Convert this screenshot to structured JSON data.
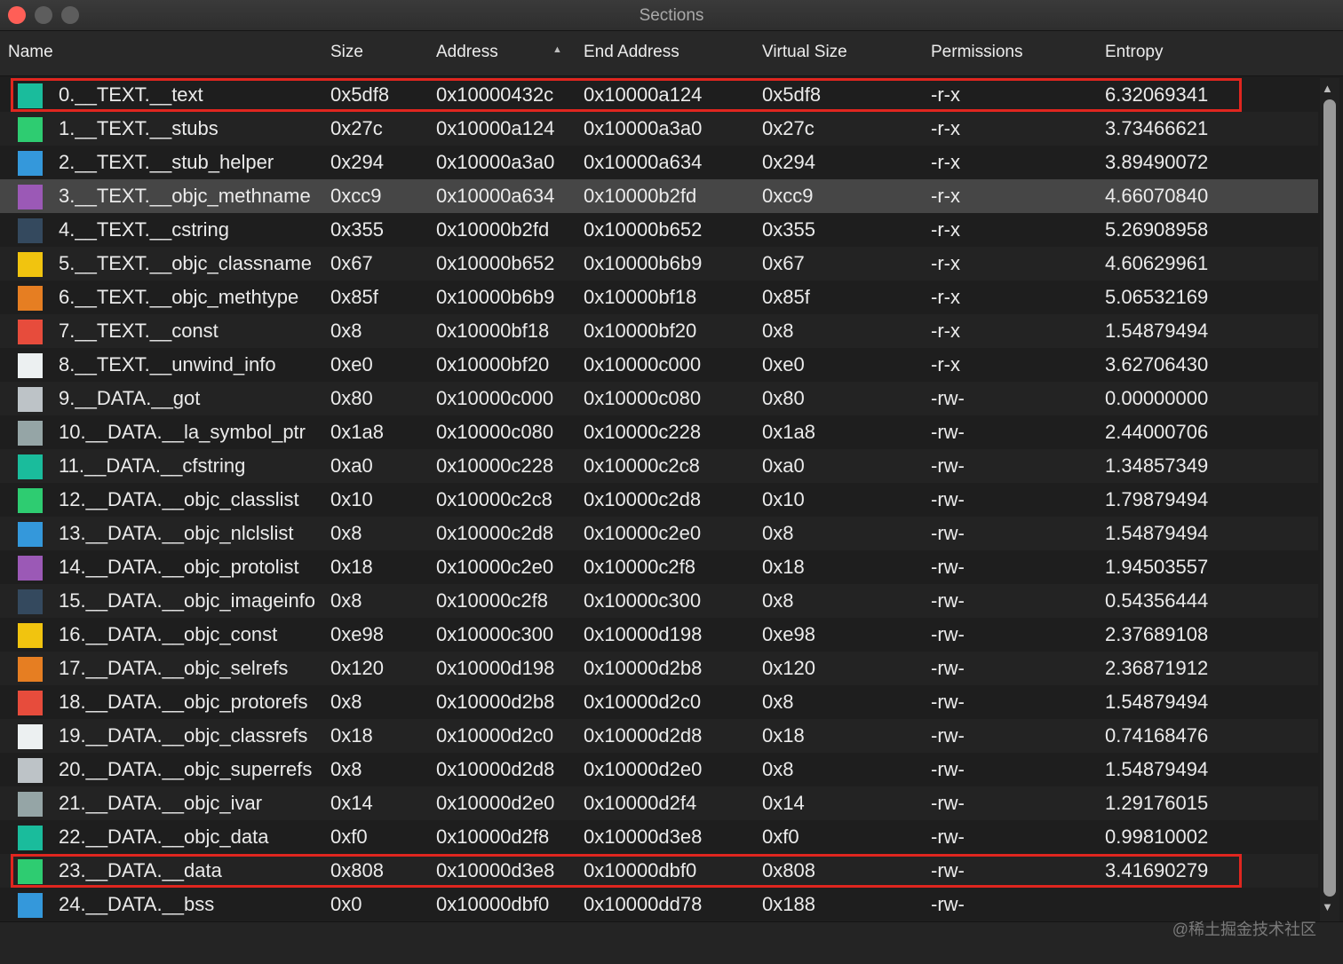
{
  "window": {
    "title": "Sections"
  },
  "columns": {
    "name": "Name",
    "size": "Size",
    "address": "Address",
    "end_address": "End Address",
    "virtual_size": "Virtual Size",
    "permissions": "Permissions",
    "entropy": "Entropy"
  },
  "sort_indicator": "▲",
  "scroll": {
    "up": "▲",
    "down": "▼"
  },
  "watermark": "@稀土掘金技术社区",
  "selected_row": 3,
  "highlighted_rows": [
    0,
    23
  ],
  "rows": [
    {
      "color": "#1abc9c",
      "name": "0.__TEXT.__text",
      "size": "0x5df8",
      "address": "0x10000432c",
      "end": "0x10000a124",
      "vsize": "0x5df8",
      "perm": "-r-x",
      "entropy": "6.32069341"
    },
    {
      "color": "#2ecc71",
      "name": "1.__TEXT.__stubs",
      "size": "0x27c",
      "address": "0x10000a124",
      "end": "0x10000a3a0",
      "vsize": "0x27c",
      "perm": "-r-x",
      "entropy": "3.73466621"
    },
    {
      "color": "#3498db",
      "name": "2.__TEXT.__stub_helper",
      "size": "0x294",
      "address": "0x10000a3a0",
      "end": "0x10000a634",
      "vsize": "0x294",
      "perm": "-r-x",
      "entropy": "3.89490072"
    },
    {
      "color": "#9b59b6",
      "name": "3.__TEXT.__objc_methname",
      "size": "0xcc9",
      "address": "0x10000a634",
      "end": "0x10000b2fd",
      "vsize": "0xcc9",
      "perm": "-r-x",
      "entropy": "4.66070840"
    },
    {
      "color": "#34495e",
      "name": "4.__TEXT.__cstring",
      "size": "0x355",
      "address": "0x10000b2fd",
      "end": "0x10000b652",
      "vsize": "0x355",
      "perm": "-r-x",
      "entropy": "5.26908958"
    },
    {
      "color": "#f1c40f",
      "name": "5.__TEXT.__objc_classname",
      "size": "0x67",
      "address": "0x10000b652",
      "end": "0x10000b6b9",
      "vsize": "0x67",
      "perm": "-r-x",
      "entropy": "4.60629961"
    },
    {
      "color": "#e67e22",
      "name": "6.__TEXT.__objc_methtype",
      "size": "0x85f",
      "address": "0x10000b6b9",
      "end": "0x10000bf18",
      "vsize": "0x85f",
      "perm": "-r-x",
      "entropy": "5.06532169"
    },
    {
      "color": "#e74c3c",
      "name": "7.__TEXT.__const",
      "size": "0x8",
      "address": "0x10000bf18",
      "end": "0x10000bf20",
      "vsize": "0x8",
      "perm": "-r-x",
      "entropy": "1.54879494"
    },
    {
      "color": "#ecf0f1",
      "name": "8.__TEXT.__unwind_info",
      "size": "0xe0",
      "address": "0x10000bf20",
      "end": "0x10000c000",
      "vsize": "0xe0",
      "perm": "-r-x",
      "entropy": "3.62706430"
    },
    {
      "color": "#bdc3c7",
      "name": "9.__DATA.__got",
      "size": "0x80",
      "address": "0x10000c000",
      "end": "0x10000c080",
      "vsize": "0x80",
      "perm": "-rw-",
      "entropy": "0.00000000"
    },
    {
      "color": "#95a5a6",
      "name": "10.__DATA.__la_symbol_ptr",
      "size": "0x1a8",
      "address": "0x10000c080",
      "end": "0x10000c228",
      "vsize": "0x1a8",
      "perm": "-rw-",
      "entropy": "2.44000706"
    },
    {
      "color": "#1abc9c",
      "name": "11.__DATA.__cfstring",
      "size": "0xa0",
      "address": "0x10000c228",
      "end": "0x10000c2c8",
      "vsize": "0xa0",
      "perm": "-rw-",
      "entropy": "1.34857349"
    },
    {
      "color": "#2ecc71",
      "name": "12.__DATA.__objc_classlist",
      "size": "0x10",
      "address": "0x10000c2c8",
      "end": "0x10000c2d8",
      "vsize": "0x10",
      "perm": "-rw-",
      "entropy": "1.79879494"
    },
    {
      "color": "#3498db",
      "name": "13.__DATA.__objc_nlclslist",
      "size": "0x8",
      "address": "0x10000c2d8",
      "end": "0x10000c2e0",
      "vsize": "0x8",
      "perm": "-rw-",
      "entropy": "1.54879494"
    },
    {
      "color": "#9b59b6",
      "name": "14.__DATA.__objc_protolist",
      "size": "0x18",
      "address": "0x10000c2e0",
      "end": "0x10000c2f8",
      "vsize": "0x18",
      "perm": "-rw-",
      "entropy": "1.94503557"
    },
    {
      "color": "#34495e",
      "name": "15.__DATA.__objc_imageinfo",
      "size": "0x8",
      "address": "0x10000c2f8",
      "end": "0x10000c300",
      "vsize": "0x8",
      "perm": "-rw-",
      "entropy": "0.54356444"
    },
    {
      "color": "#f1c40f",
      "name": "16.__DATA.__objc_const",
      "size": "0xe98",
      "address": "0x10000c300",
      "end": "0x10000d198",
      "vsize": "0xe98",
      "perm": "-rw-",
      "entropy": "2.37689108"
    },
    {
      "color": "#e67e22",
      "name": "17.__DATA.__objc_selrefs",
      "size": "0x120",
      "address": "0x10000d198",
      "end": "0x10000d2b8",
      "vsize": "0x120",
      "perm": "-rw-",
      "entropy": "2.36871912"
    },
    {
      "color": "#e74c3c",
      "name": "18.__DATA.__objc_protorefs",
      "size": "0x8",
      "address": "0x10000d2b8",
      "end": "0x10000d2c0",
      "vsize": "0x8",
      "perm": "-rw-",
      "entropy": "1.54879494"
    },
    {
      "color": "#ecf0f1",
      "name": "19.__DATA.__objc_classrefs",
      "size": "0x18",
      "address": "0x10000d2c0",
      "end": "0x10000d2d8",
      "vsize": "0x18",
      "perm": "-rw-",
      "entropy": "0.74168476"
    },
    {
      "color": "#bdc3c7",
      "name": "20.__DATA.__objc_superrefs",
      "size": "0x8",
      "address": "0x10000d2d8",
      "end": "0x10000d2e0",
      "vsize": "0x8",
      "perm": "-rw-",
      "entropy": "1.54879494"
    },
    {
      "color": "#95a5a6",
      "name": "21.__DATA.__objc_ivar",
      "size": "0x14",
      "address": "0x10000d2e0",
      "end": "0x10000d2f4",
      "vsize": "0x14",
      "perm": "-rw-",
      "entropy": "1.29176015"
    },
    {
      "color": "#1abc9c",
      "name": "22.__DATA.__objc_data",
      "size": "0xf0",
      "address": "0x10000d2f8",
      "end": "0x10000d3e8",
      "vsize": "0xf0",
      "perm": "-rw-",
      "entropy": "0.99810002"
    },
    {
      "color": "#2ecc71",
      "name": "23.__DATA.__data",
      "size": "0x808",
      "address": "0x10000d3e8",
      "end": "0x10000dbf0",
      "vsize": "0x808",
      "perm": "-rw-",
      "entropy": "3.41690279"
    },
    {
      "color": "#3498db",
      "name": "24.__DATA.__bss",
      "size": "0x0",
      "address": "0x10000dbf0",
      "end": "0x10000dd78",
      "vsize": "0x188",
      "perm": "-rw-",
      "entropy": ""
    }
  ]
}
